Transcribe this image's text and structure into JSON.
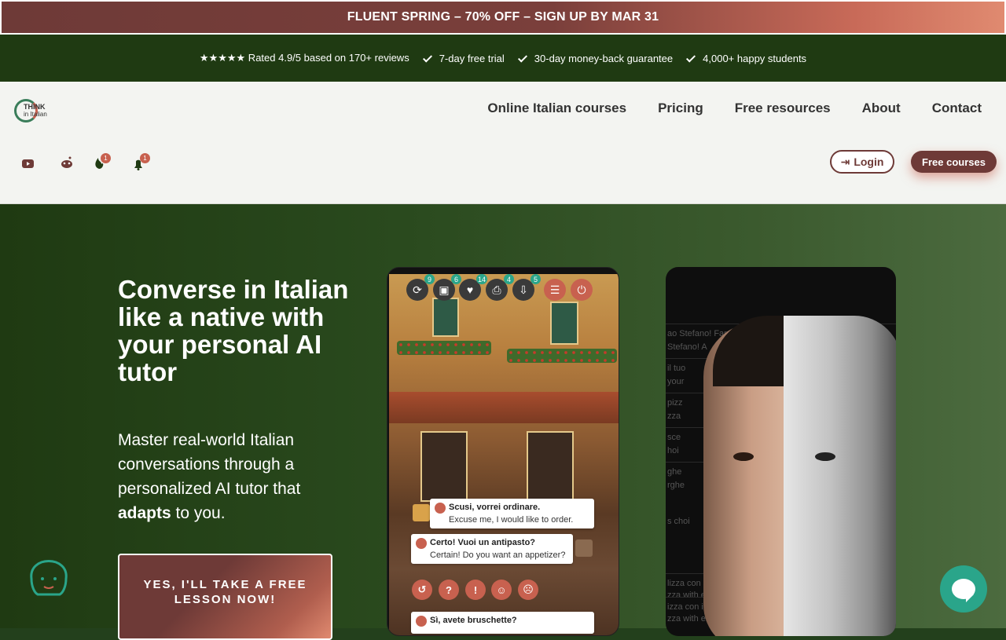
{
  "promo": {
    "text": "FLUENT SPRING – 70% OFF – SIGN UP BY MAR 31"
  },
  "trust": {
    "rating": "★★★★★ Rated 4.9/5 based on 170+ reviews",
    "items": [
      "7-day free trial",
      "30-day money-back guarantee",
      "4,000+ happy students"
    ]
  },
  "logo": {
    "line1": "THINK",
    "line2": "in Italian"
  },
  "nav": {
    "items": [
      "Online Italian courses",
      "Pricing",
      "Free resources",
      "About",
      "Contact"
    ],
    "login": "Login",
    "free": "Free courses",
    "badges": [
      "1",
      "1"
    ]
  },
  "hero": {
    "title": "Converse in Italian like a native with your personal AI tutor",
    "subtitle_pre": "Master real-world Italian conversations through a personalized AI tutor that ",
    "subtitle_bold": "adapts",
    "subtitle_post": " to you.",
    "cta": "YES, I'LL TAKE A FREE LESSON NOW!"
  },
  "phone": {
    "toolbar": [
      {
        "icon": "repeat-icon",
        "count": "9"
      },
      {
        "icon": "image-icon",
        "count": "6"
      },
      {
        "icon": "heartbeat-icon",
        "count": "14"
      },
      {
        "icon": "print-icon",
        "count": "4"
      },
      {
        "icon": "download-icon",
        "count": "5"
      },
      {
        "icon": "settings-icon",
        "count": ""
      },
      {
        "icon": "power-icon",
        "count": ""
      }
    ],
    "msg1": {
      "it": "Scusi, vorrei ordinare.",
      "en": "Excuse me, I would like to order."
    },
    "msg2": {
      "it": "Certo! Vuoi un antipasto?",
      "en": "Certain! Do you want an appetizer?"
    },
    "msg3": {
      "it": "Sì, avete bruschette?"
    },
    "reactions": [
      "↺",
      "?",
      "!",
      "☺",
      "☹"
    ]
  },
  "ai": {
    "ghost": [
      "ao Stefano! Fam",
      "Stefano! A",
      "il tuo",
      "your",
      "pizz",
      "zza",
      "sce",
      "hoi",
      "ghe",
      "rghe",
      "s choi",
      "lizza con ingredi",
      "zza with extra ingre",
      "izza con ingredi",
      "zza with extra ingre"
    ]
  }
}
